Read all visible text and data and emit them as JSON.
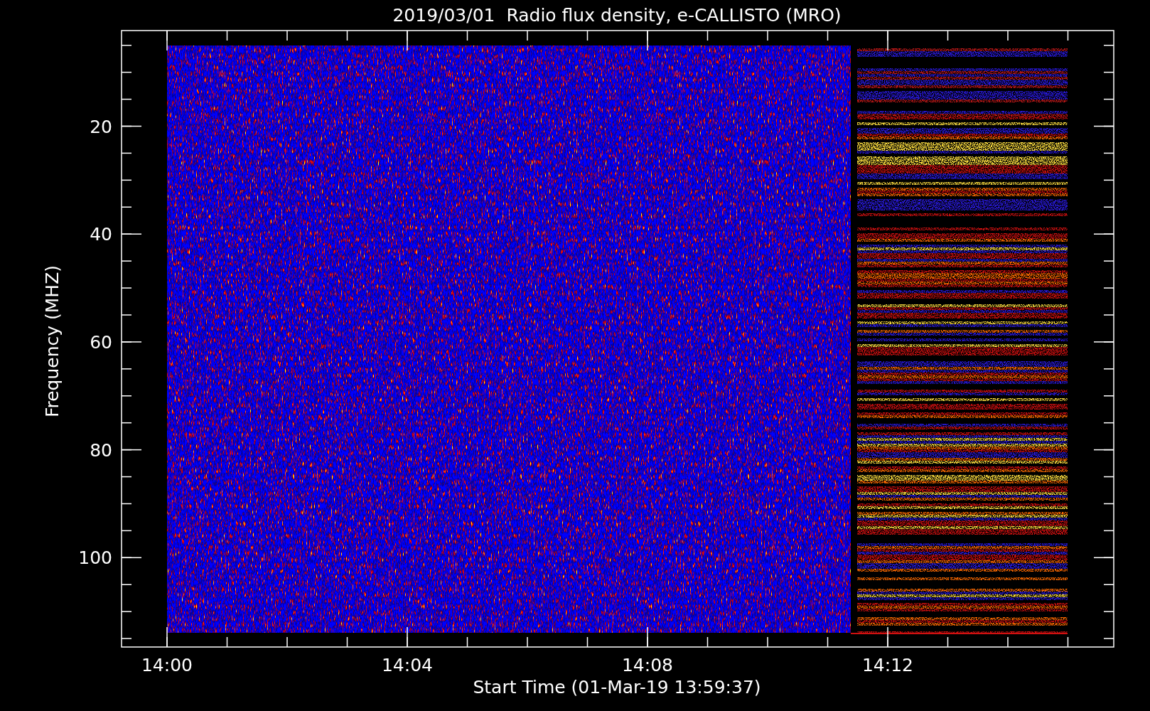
{
  "plot": {
    "title": "2019/03/01  Radio flux density, e-CALLISTO (MRO)",
    "xlabel": "Start Time (01-Mar-19 13:59:37)",
    "ylabel": "Frequency (MHZ)",
    "xticks": [
      "14:00",
      "14:04",
      "14:08",
      "14:12"
    ],
    "yticks": [
      "20",
      "40",
      "60",
      "80",
      "100"
    ]
  }
}
